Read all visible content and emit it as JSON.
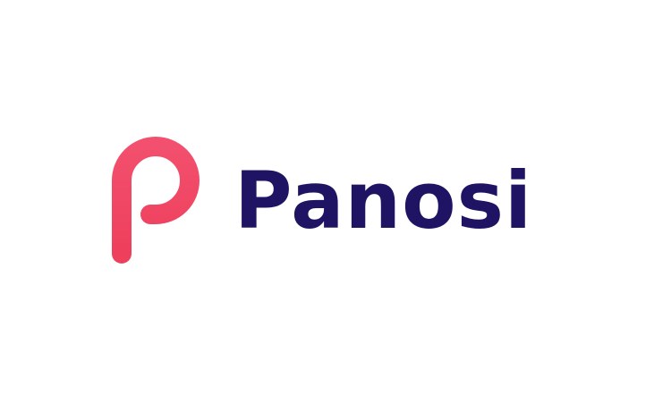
{
  "brand": {
    "name": "Panosi",
    "icon": "p-letter-icon",
    "colors": {
      "wordmark": "#1f1464",
      "icon_gradient_start": "#f2506e",
      "icon_gradient_end": "#ee3f5c",
      "background": "#ffffff"
    }
  }
}
